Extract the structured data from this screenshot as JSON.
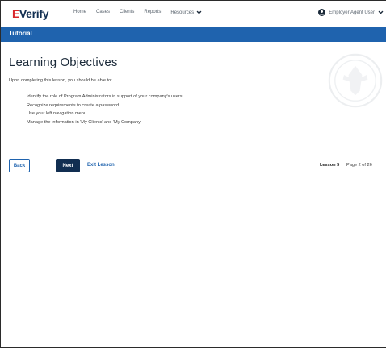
{
  "nav": {
    "logo_e": "E",
    "logo_rest": "Verify",
    "links": [
      "Home",
      "Cases",
      "Clients",
      "Reports"
    ],
    "resources": "Resources",
    "user": "Employer Agent User",
    "icons": [
      "user-icon",
      "chevron-down-icon"
    ]
  },
  "tutorial_bar": {
    "title": "Tutorial"
  },
  "content": {
    "heading": "Learning Objectives",
    "intro": "Upon completing this lesson, you should be able to:",
    "objectives": [
      "Identify the role of Program Administrators in support of your company's users",
      "Recognize requirements to create a password",
      "Use your left navigation menu",
      "Manage the information in 'My Clients' and 'My Company'"
    ]
  },
  "footer": {
    "back": "Back",
    "next": "Next",
    "exit": "Exit Lesson",
    "lesson": "Lesson 5",
    "page": "Page 2 of 26"
  },
  "colors": {
    "brand_blue": "#1f63ae",
    "dark_navy": "#112e51",
    "logo_red": "#d8262b"
  }
}
